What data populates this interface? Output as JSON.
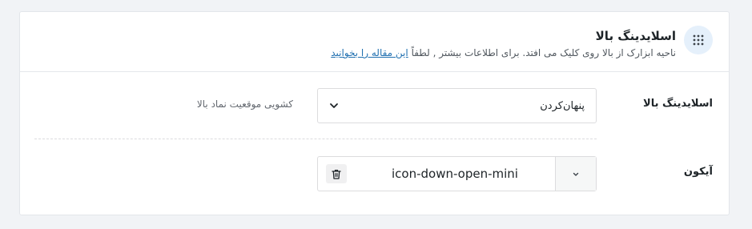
{
  "header": {
    "title": "اسلایدینگ بالا",
    "description": "ناحیه ابزارک از بالا روی کلیک می افتد. برای اطلاعات بیشتر , لطفاً",
    "link_text": "این مقاله را بخوانید",
    "icon": "grid-dots-icon",
    "icon_bg_color": "#e5f0fb"
  },
  "sliding_row": {
    "label": "اسلایدینگ بالا",
    "hint": "کشویی موقعیت نماد بالا",
    "select_value": "پنهان‌کردن",
    "select_icon": "chevron-down-icon"
  },
  "icon_row": {
    "label": "آیکون",
    "icon_name": "icon-down-open-mini",
    "toggle_icon": "chevron-down-icon",
    "remove_icon": "trash-icon"
  },
  "colors": {
    "link": "#2271b1",
    "border": "#dcdcde",
    "background": "#f1f3f6"
  }
}
